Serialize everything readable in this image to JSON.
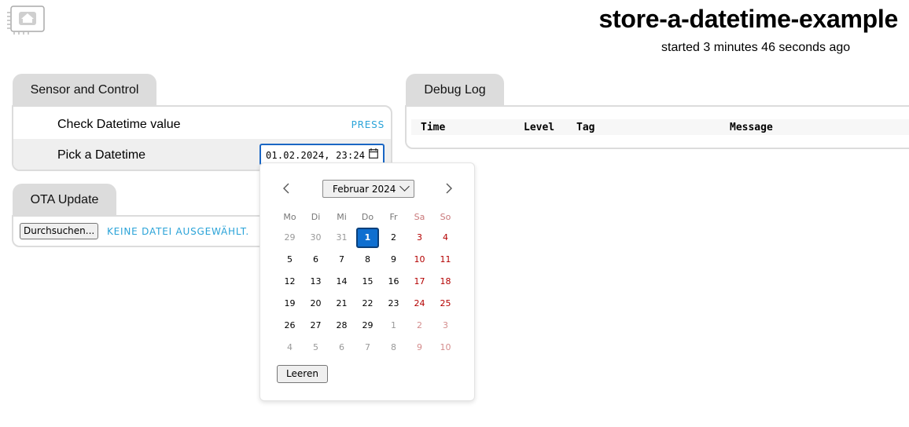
{
  "header": {
    "title": "store-a-datetime-example",
    "subtitle": "started 3 minutes 46 seconds ago",
    "logo_icon": "home-icon"
  },
  "sensor_panel": {
    "tab": "Sensor and Control",
    "rows": [
      {
        "label": "Check Datetime value",
        "action": "PRESS"
      },
      {
        "label": "Pick a Datetime",
        "value": "01.02.2024, 23:24"
      }
    ]
  },
  "ota_panel": {
    "tab": "OTA Update",
    "browse_label": "Durchsuchen...",
    "no_file_label": "KEINE DATEI AUSGEWÄHLT."
  },
  "debug_panel": {
    "tab": "Debug Log",
    "columns": [
      "Time",
      "Level",
      "Tag",
      "Message"
    ]
  },
  "calendar": {
    "month_label": "Februar 2024",
    "weekdays": [
      "Mo",
      "Di",
      "Mi",
      "Do",
      "Fr",
      "Sa",
      "So"
    ],
    "weeks": [
      [
        "29",
        "30",
        "31",
        "1",
        "2",
        "3",
        "4"
      ],
      [
        "5",
        "6",
        "7",
        "8",
        "9",
        "10",
        "11"
      ],
      [
        "12",
        "13",
        "14",
        "15",
        "16",
        "17",
        "18"
      ],
      [
        "19",
        "20",
        "21",
        "22",
        "23",
        "24",
        "25"
      ],
      [
        "26",
        "27",
        "28",
        "29",
        "1",
        "2",
        "3"
      ],
      [
        "4",
        "5",
        "6",
        "7",
        "8",
        "9",
        "10"
      ]
    ],
    "current_month_flags": [
      [
        false,
        false,
        false,
        true,
        true,
        true,
        true
      ],
      [
        true,
        true,
        true,
        true,
        true,
        true,
        true
      ],
      [
        true,
        true,
        true,
        true,
        true,
        true,
        true
      ],
      [
        true,
        true,
        true,
        true,
        true,
        true,
        true
      ],
      [
        true,
        true,
        true,
        true,
        false,
        false,
        false
      ],
      [
        false,
        false,
        false,
        false,
        false,
        false,
        false
      ]
    ],
    "selected_day": "1",
    "clear_label": "Leeren"
  },
  "colors": {
    "accent": "#2aa3d8",
    "selected": "#0f6fd0",
    "weekend": "#b40000",
    "tab_bg": "#dcdcdc"
  }
}
